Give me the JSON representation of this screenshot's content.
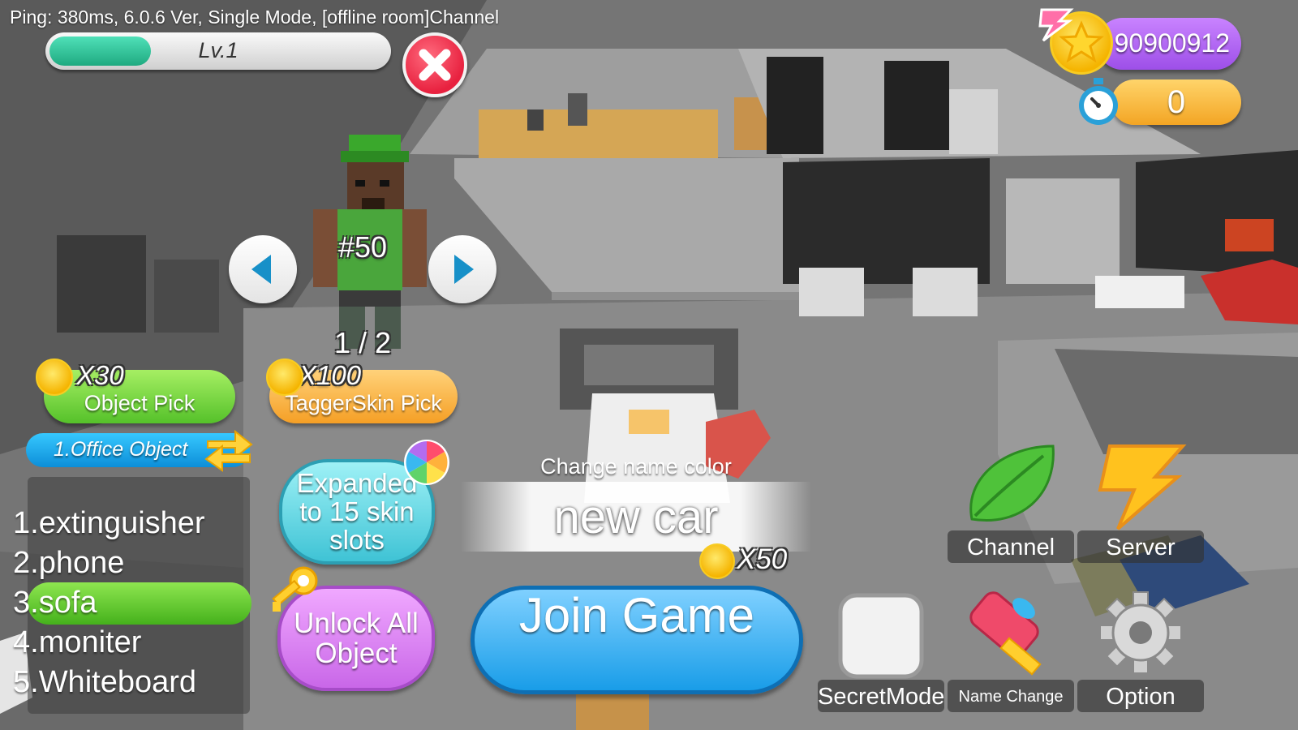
{
  "status": "Ping: 380ms, 6.0.6 Ver, Single Mode, [offline room]Channel",
  "level": {
    "label": "Lv.1",
    "progress_fraction": 0.3
  },
  "currency": {
    "coins": "90900912",
    "timer": "0"
  },
  "skin": {
    "number": "#50",
    "page": "1 / 2"
  },
  "picks": {
    "object_pick": {
      "cost": "X30",
      "label": "Object Pick"
    },
    "tagger_pick": {
      "cost": "X100",
      "label": "TaggerSkin Pick"
    }
  },
  "category": {
    "label": "1.Office Object"
  },
  "object_list": {
    "items": [
      "1.extinguisher",
      "2.phone",
      "3.sofa",
      "4.moniter",
      "5.Whiteboard"
    ],
    "selected_index": 2
  },
  "expand_slots": {
    "label": "Expanded to 15 skin slots"
  },
  "unlock_all": {
    "label": "Unlock All Object"
  },
  "name": {
    "color_label": "Change name color",
    "value": "new car",
    "cost": "X50"
  },
  "join": {
    "label": "Join Game"
  },
  "menu": {
    "channel": "Channel",
    "server": "Server",
    "secret_mode": "SecretMode",
    "name_change": "Name Change",
    "option": "Option"
  },
  "colors": {
    "coin_bar": "#b56cf5",
    "timer_bar": "#f6b640",
    "level_fill": "#2fc28f",
    "close": "#e8213f",
    "object_pick": "#6ed23a",
    "tagger_pick": "#f8b640",
    "join": "#2ba8ef"
  }
}
